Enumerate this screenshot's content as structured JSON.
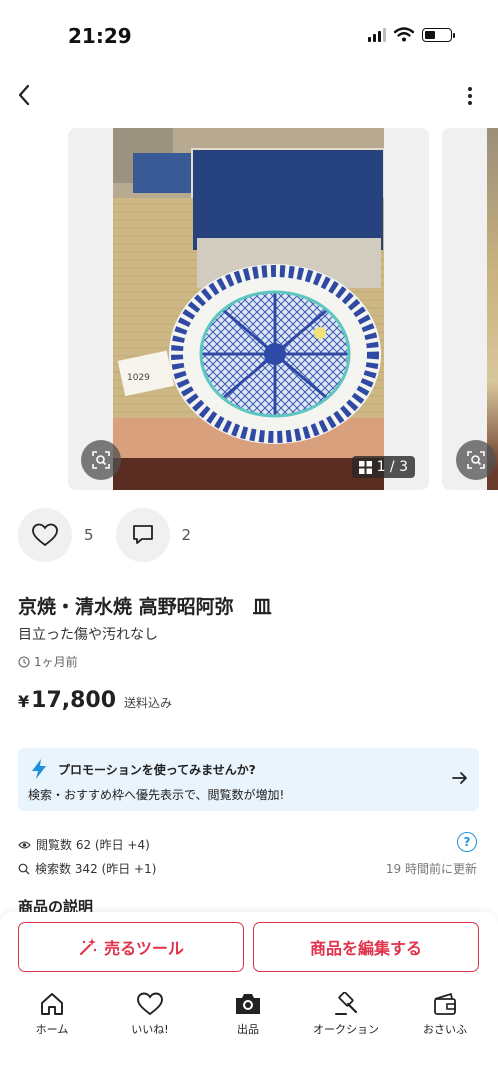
{
  "status_bar": {
    "time": "21:29",
    "battery_level": 0.4
  },
  "gallery": {
    "counter": "1 / 3",
    "photo_label": "1029"
  },
  "actions": {
    "like_count": "5",
    "comment_count": "2"
  },
  "product": {
    "title": "京焼・清水焼 高野昭阿弥　皿",
    "condition": "目立った傷や汚れなし",
    "posted": "1ヶ月前",
    "price_symbol": "¥",
    "price": "17,800",
    "shipping": "送料込み"
  },
  "promo": {
    "title": "プロモーションを使ってみませんか?",
    "description": "検索・おすすめ枠へ優先表示で、閲覧数が増加!",
    "accent_color": "#1f8fe0"
  },
  "stats": {
    "views": "閲覧数  62 (昨日 +4)",
    "searches": "検索数  342 (昨日 +1)",
    "updated": "19 時間前に更新"
  },
  "description_heading": "商品の説明",
  "buttons": {
    "sell_tool": "売るツール",
    "edit": "商品を編集する",
    "accent_color": "#e0334b"
  },
  "tabbar": [
    {
      "label": "ホーム",
      "icon": "home-icon"
    },
    {
      "label": "いいね!",
      "icon": "heart-icon"
    },
    {
      "label": "出品",
      "icon": "camera-icon"
    },
    {
      "label": "オークション",
      "icon": "gavel-icon"
    },
    {
      "label": "おさいふ",
      "icon": "wallet-icon"
    }
  ]
}
